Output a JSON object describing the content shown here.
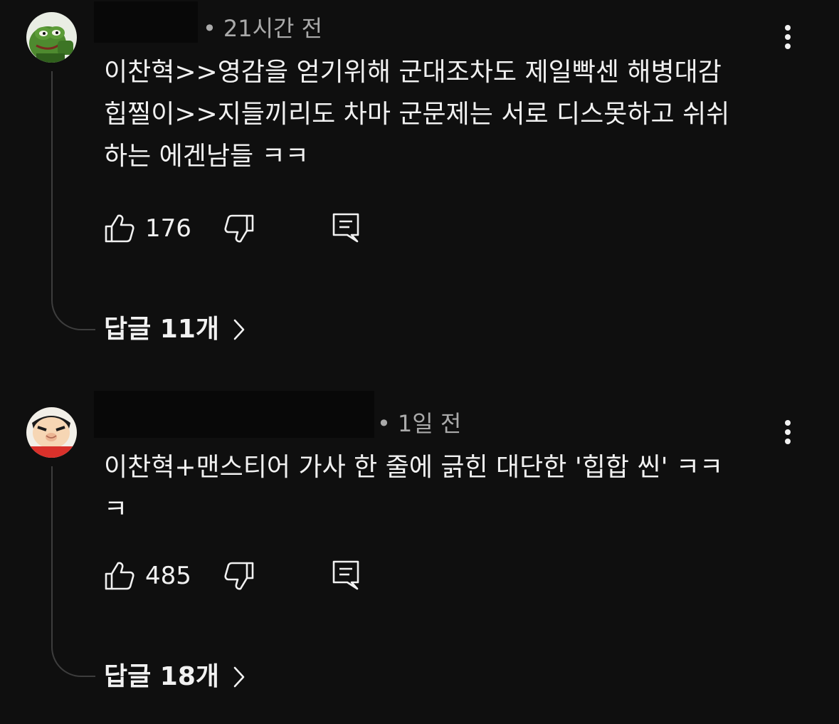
{
  "comments": [
    {
      "time": "21시간 전",
      "dot": "•",
      "text": "이찬혁>>영감을 얻기위해 군대조차도 제일빡센 해병대감\n힙찔이>>지들끼리도 차마 군문제는 서로 디스못하고 쉬쉬\n하는 에겐남들 ㅋㅋ",
      "likes": "176",
      "replies": "답글 11개",
      "avatar_icon": "frog-avatar-icon"
    },
    {
      "time": "1일 전",
      "dot": "•",
      "text": "이찬혁+맨스티어 가사 한 줄에 긁힌 대단한 '힙합 씬' ㅋㅋ\nㅋ",
      "likes": "485",
      "replies": "답글 18개",
      "avatar_icon": "cartoon-boy-avatar-icon"
    }
  ],
  "icons": {
    "like": "thumbs-up-icon",
    "dislike": "thumbs-down-icon",
    "reply": "comment-icon",
    "more": "more-vert-icon",
    "chevron": "chevron-right-icon"
  },
  "colors": {
    "background": "#0f0f0f",
    "text": "#f1f1f1",
    "secondary_text": "#aaaaaa",
    "thread_line": "#3d3d3d"
  }
}
